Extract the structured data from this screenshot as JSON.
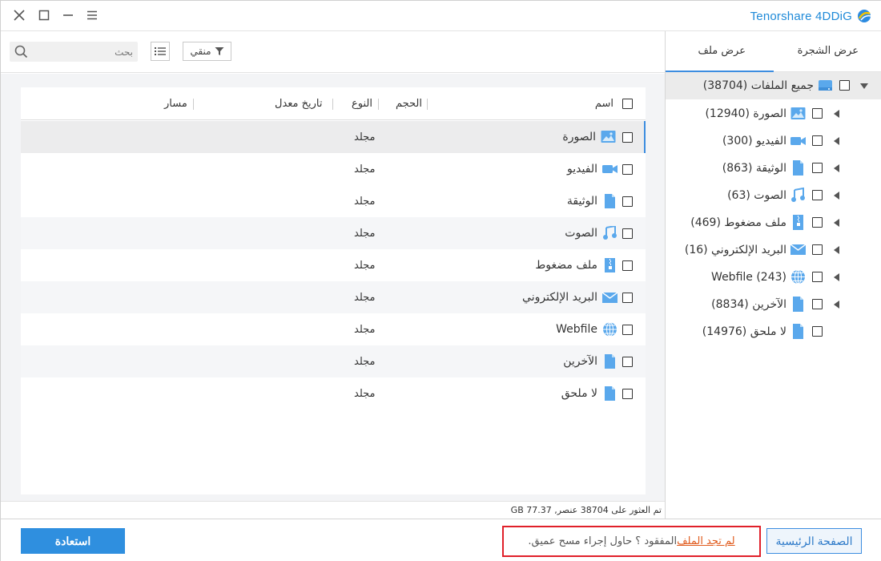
{
  "app": {
    "brand": "Tenorshare 4DDiG",
    "accent_color": "#3c8de0",
    "window_buttons": [
      "close-icon",
      "maximize-icon",
      "minimize-icon",
      "menu-icon"
    ]
  },
  "toolbar": {
    "search_placeholder": "بحث",
    "filter_label": "منقي"
  },
  "table": {
    "columns": {
      "name": "اسم",
      "size": "الحجم",
      "type": "النوع",
      "modified": "تاريخ معدل",
      "path": "مسار"
    },
    "rows": [
      {
        "name": "الصورة",
        "type": "مجلد",
        "icon": "image-icon"
      },
      {
        "name": "الفيديو",
        "type": "مجلد",
        "icon": "video-icon"
      },
      {
        "name": "الوثيقة",
        "type": "مجلد",
        "icon": "document-icon"
      },
      {
        "name": "الصوت",
        "type": "مجلد",
        "icon": "audio-icon"
      },
      {
        "name": "ملف مضغوط",
        "type": "مجلد",
        "icon": "archive-icon"
      },
      {
        "name": "البريد الإلكتروني",
        "type": "مجلد",
        "icon": "email-icon"
      },
      {
        "name": "Webfile",
        "type": "مجلد",
        "icon": "globe-icon"
      },
      {
        "name": "الآخرين",
        "type": "مجلد",
        "icon": "other-file-icon"
      },
      {
        "name": "لا ملحق",
        "type": "مجلد",
        "icon": "no-extension-icon"
      }
    ]
  },
  "status": {
    "text": "تم العثور على 38704 عنصر, GB 77.37"
  },
  "sidebar": {
    "tabs": [
      "عرض الشجرة",
      "عرض ملف"
    ],
    "active_tab": "عرض الشجرة",
    "root": "جميع الملفات (38704)",
    "items": [
      {
        "label": "الصورة (12940)",
        "icon": "image-icon"
      },
      {
        "label": "الفيديو (300)",
        "icon": "video-icon"
      },
      {
        "label": "الوثيقة (863)",
        "icon": "document-icon"
      },
      {
        "label": "الصوت (63)",
        "icon": "audio-icon"
      },
      {
        "label": "ملف مضغوط (469)",
        "icon": "archive-icon"
      },
      {
        "label": "البريد الإلكتروني (16)",
        "icon": "email-icon"
      },
      {
        "label": "Webfile (243)",
        "icon": "globe-icon"
      },
      {
        "label": "الآخرين (8834)",
        "icon": "other-file-icon"
      },
      {
        "label": "لا ملحق (14976)",
        "icon": "no-extension-icon"
      }
    ]
  },
  "footer": {
    "recover_label": "استعادة",
    "home_label": "الصفحة الرئيسية",
    "hint_link": "لم تجد الملف",
    "hint_rest": " المفقود ؟ حاول إجراء مسح عميق."
  }
}
